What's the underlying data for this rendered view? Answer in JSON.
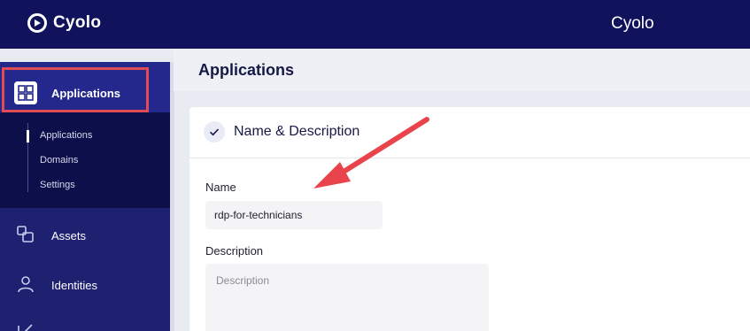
{
  "topbar": {
    "logo_text": "Cyolo",
    "title": "Cyolo"
  },
  "sidebar": {
    "active_item": "Applications",
    "submenu": [
      "Applications",
      "Domains",
      "Settings"
    ],
    "items": [
      {
        "label": "Assets",
        "icon": "assets-icon"
      },
      {
        "label": "Identities",
        "icon": "person-icon"
      }
    ]
  },
  "page": {
    "title": "Applications"
  },
  "card": {
    "section_title": "Name & Description",
    "name_label": "Name",
    "name_value": "rdp-for-technicians",
    "description_label": "Description",
    "description_placeholder": "Description"
  },
  "colors": {
    "topbar": "#10125c",
    "sidebar": "#1e2170",
    "highlight_box": "#e04b55",
    "annotation_arrow": "#e9434b"
  }
}
